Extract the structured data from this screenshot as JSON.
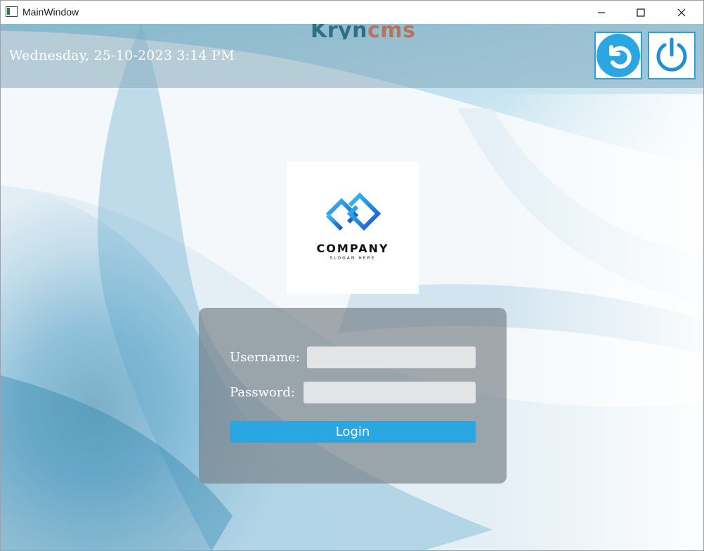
{
  "window": {
    "title": "MainWindow"
  },
  "header": {
    "brand": {
      "part1": "Kryn",
      "part2": "cms"
    },
    "datetime": "Wednesday, 25-10-2023 3:14 PM",
    "buttons": [
      {
        "icon": "refresh-icon"
      },
      {
        "icon": "power-icon"
      }
    ]
  },
  "logo": {
    "name": "COMPANY",
    "slogan": "SLOGAN HERE"
  },
  "login": {
    "username_label": "Username:",
    "password_label": "Password:",
    "username_value": "",
    "password_value": "",
    "login_label": "Login"
  },
  "colors": {
    "accent": "#2aa6e3",
    "header_band": "#84aabc",
    "panel": "#78808a"
  }
}
